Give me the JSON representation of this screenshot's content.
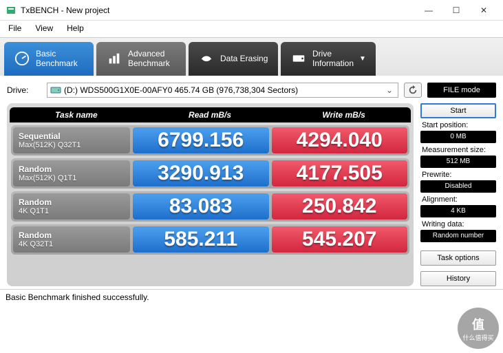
{
  "window": {
    "title": "TxBENCH - New project"
  },
  "menu": {
    "file": "File",
    "view": "View",
    "help": "Help"
  },
  "tabs": {
    "basic": "Basic\nBenchmark",
    "advanced": "Advanced\nBenchmark",
    "erasing": "Data Erasing",
    "drive": "Drive\nInformation"
  },
  "drive": {
    "label": "Drive:",
    "text": "(D:) WDS500G1X0E-00AFY0   465.74 GB (976,738,304 Sectors)",
    "filemode": "FILE mode"
  },
  "headers": {
    "task": "Task name",
    "read": "Read mB/s",
    "write": "Write mB/s"
  },
  "rows": [
    {
      "t1": "Sequential",
      "t2": "Max(512K) Q32T1",
      "read": "6799.156",
      "write": "4294.040"
    },
    {
      "t1": "Random",
      "t2": "Max(512K) Q1T1",
      "read": "3290.913",
      "write": "4177.505"
    },
    {
      "t1": "Random",
      "t2": "4K Q1T1",
      "read": "83.083",
      "write": "250.842"
    },
    {
      "t1": "Random",
      "t2": "4K Q32T1",
      "read": "585.211",
      "write": "545.207"
    }
  ],
  "side": {
    "start": "Start",
    "startpos_label": "Start position:",
    "startpos_val": "0 MB",
    "measure_label": "Measurement size:",
    "measure_val": "512 MB",
    "prewrite_label": "Prewrite:",
    "prewrite_val": "Disabled",
    "align_label": "Alignment:",
    "align_val": "4 KB",
    "wdata_label": "Writing data:",
    "wdata_val": "Random number",
    "taskopt": "Task options",
    "history": "History"
  },
  "status": "Basic Benchmark finished successfully.",
  "watermark": {
    "l1": "值",
    "l2": "什么值得买"
  }
}
